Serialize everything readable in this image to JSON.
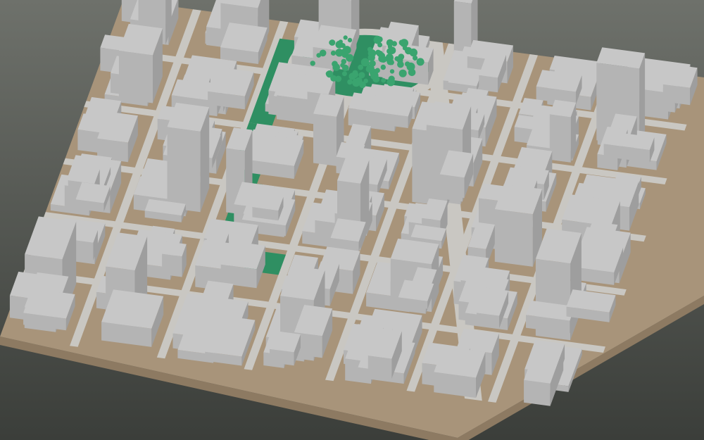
{
  "scene": {
    "kind": "3d-city-block-model",
    "projection": "isometric",
    "colors": {
      "background_top": "#6e716b",
      "background_bottom": "#3b3e3a",
      "ground": "#a8947a",
      "ground_side": "#8d7a62",
      "road": "#c9c7c2",
      "building_top": "#c7c7c7",
      "building_left": "#b4b4b4",
      "building_right": "#9e9e9e",
      "park": "#2f8f62",
      "tree": "#3aa46f",
      "water": "#8fb3d1"
    },
    "features": [
      "roundabout-park",
      "linear-park",
      "tower-blocks",
      "street-grid",
      "tree-clusters"
    ]
  }
}
